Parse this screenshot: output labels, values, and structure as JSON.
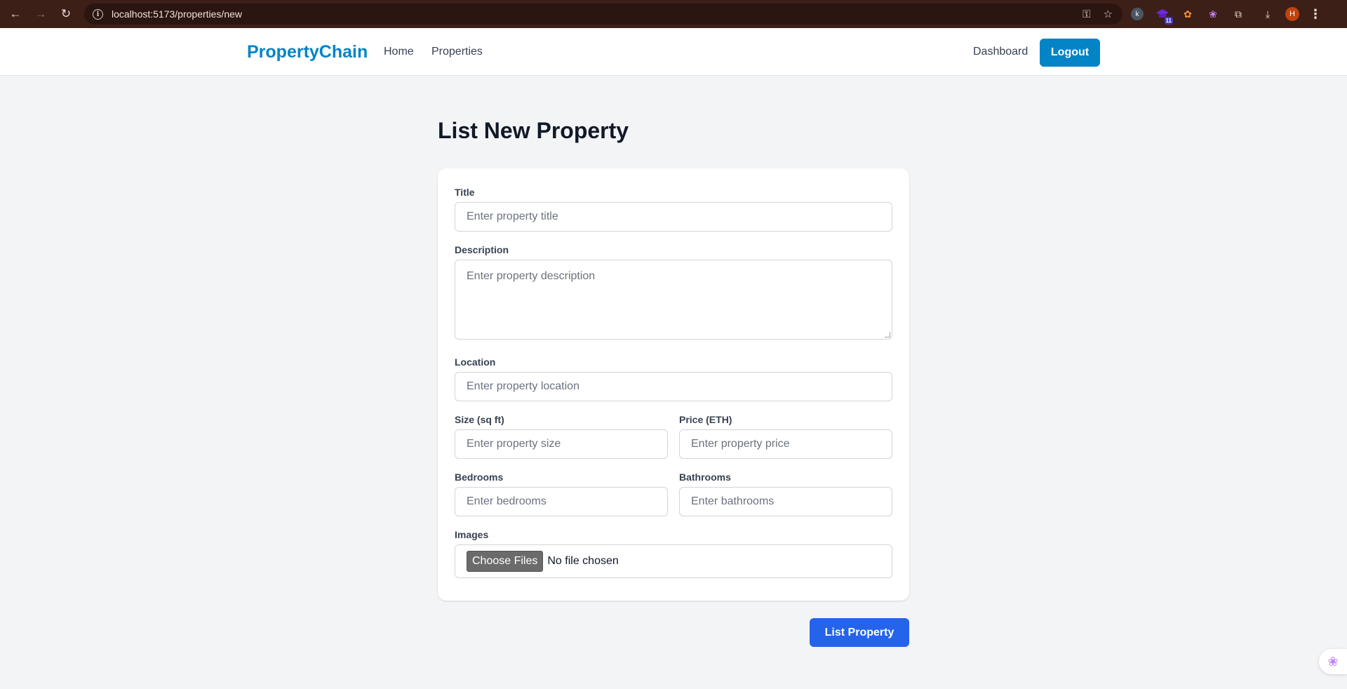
{
  "browser": {
    "url": "localhost:5173/properties/new",
    "back_glyph": "←",
    "forward_glyph": "→",
    "reload_glyph": "↻",
    "info_glyph": "i",
    "key_glyph": "⚿",
    "star_glyph": "☆",
    "extensions": {
      "ext1_glyph": "k",
      "ext2_badge": "11",
      "ext3_glyph": "✿",
      "ext4_glyph": "❀",
      "puzzle_glyph": "⧉",
      "download_glyph": "⤓",
      "avatar_letter": "H",
      "menu_glyph": "⋮"
    }
  },
  "navbar": {
    "brand": "PropertyChain",
    "links": {
      "home": "Home",
      "properties": "Properties",
      "dashboard": "Dashboard"
    },
    "logout": "Logout"
  },
  "page": {
    "title": "List New Property"
  },
  "form": {
    "title": {
      "label": "Title",
      "placeholder": "Enter property title"
    },
    "description": {
      "label": "Description",
      "placeholder": "Enter property description"
    },
    "location": {
      "label": "Location",
      "placeholder": "Enter property location"
    },
    "size": {
      "label": "Size (sq ft)",
      "placeholder": "Enter property size"
    },
    "price": {
      "label": "Price (ETH)",
      "placeholder": "Enter property price"
    },
    "bedrooms": {
      "label": "Bedrooms",
      "placeholder": "Enter bedrooms"
    },
    "bathrooms": {
      "label": "Bathrooms",
      "placeholder": "Enter bathrooms"
    },
    "images": {
      "label": "Images",
      "button": "Choose Files",
      "status": "No file chosen"
    },
    "submit": "List Property"
  },
  "floating": {
    "glyph": "❀"
  },
  "colors": {
    "brand": "#0284c7",
    "primary": "#2563eb",
    "browser_bar": "#3c1f17"
  }
}
